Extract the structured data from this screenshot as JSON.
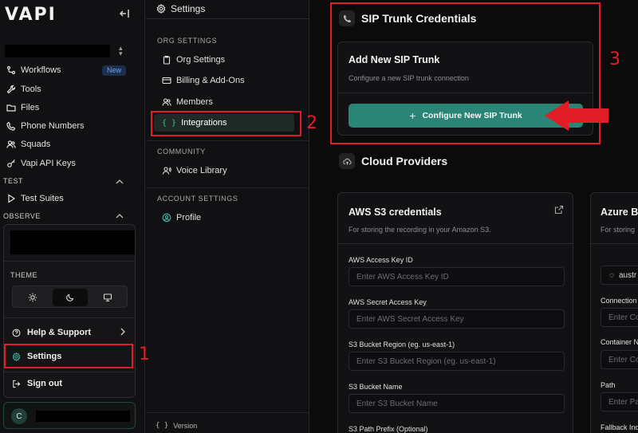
{
  "sidebar": {
    "logo": "VAPI",
    "new_badge": "New",
    "nav": {
      "workflows": "Workflows",
      "tools": "Tools",
      "files": "Files",
      "phone_numbers": "Phone Numbers",
      "squads": "Squads",
      "api_keys": "Vapi API Keys",
      "test_suites": "Test Suites"
    },
    "sections": {
      "test": "TEST",
      "observe": "OBSERVE"
    },
    "popup": {
      "theme_label": "THEME",
      "help": "Help & Support",
      "settings": "Settings",
      "sign_out": "Sign out"
    },
    "account": {
      "avatar_initial": "C"
    }
  },
  "settings_nav": {
    "title": "Settings",
    "org_settings_label": "ORG SETTINGS",
    "items": {
      "org_settings": "Org Settings",
      "billing": "Billing & Add-Ons",
      "members": "Members",
      "integrations": "Integrations"
    },
    "community_label": "COMMUNITY",
    "voice_library": "Voice Library",
    "account_settings_label": "ACCOUNT SETTINGS",
    "profile": "Profile",
    "version": "Version"
  },
  "main": {
    "sip_section_title": "SIP Trunk Credentials",
    "sip_card": {
      "title": "Add New SIP Trunk",
      "subtitle": "Configure a new SIP trunk connection",
      "button": "Configure New SIP Trunk"
    },
    "cloud_section_title": "Cloud Providers",
    "aws": {
      "title": "AWS S3 credentials",
      "subtitle": "For storing the recording in your Amazon S3.",
      "fields": [
        {
          "label": "AWS Access Key ID",
          "placeholder": "Enter AWS Access Key ID"
        },
        {
          "label": "AWS Secret Access Key",
          "placeholder": "Enter AWS Secret Access Key"
        },
        {
          "label": "S3 Bucket Region (eg. us-east-1)",
          "placeholder": "Enter S3 Bucket Region (eg. us-east-1)"
        },
        {
          "label": "S3 Bucket Name",
          "placeholder": "Enter S3 Bucket Name"
        },
        {
          "label": "S3 Path Prefix (Optional)"
        }
      ]
    },
    "azure": {
      "title": "Azure B",
      "subtitle": "For storing",
      "region": "austr",
      "fields": [
        {
          "label": "Connection",
          "placeholder": "Enter Co"
        },
        {
          "label": "Container N",
          "placeholder": "Enter Co"
        },
        {
          "label": "Path",
          "placeholder": "Enter Pa"
        },
        {
          "label": "Fallback Indi"
        }
      ]
    }
  },
  "annotations": {
    "step1": "1",
    "step2": "2",
    "step3": "3"
  },
  "colors": {
    "accent": "#2a8577",
    "annotation": "#e11d28",
    "background": "#0b0b0c"
  }
}
